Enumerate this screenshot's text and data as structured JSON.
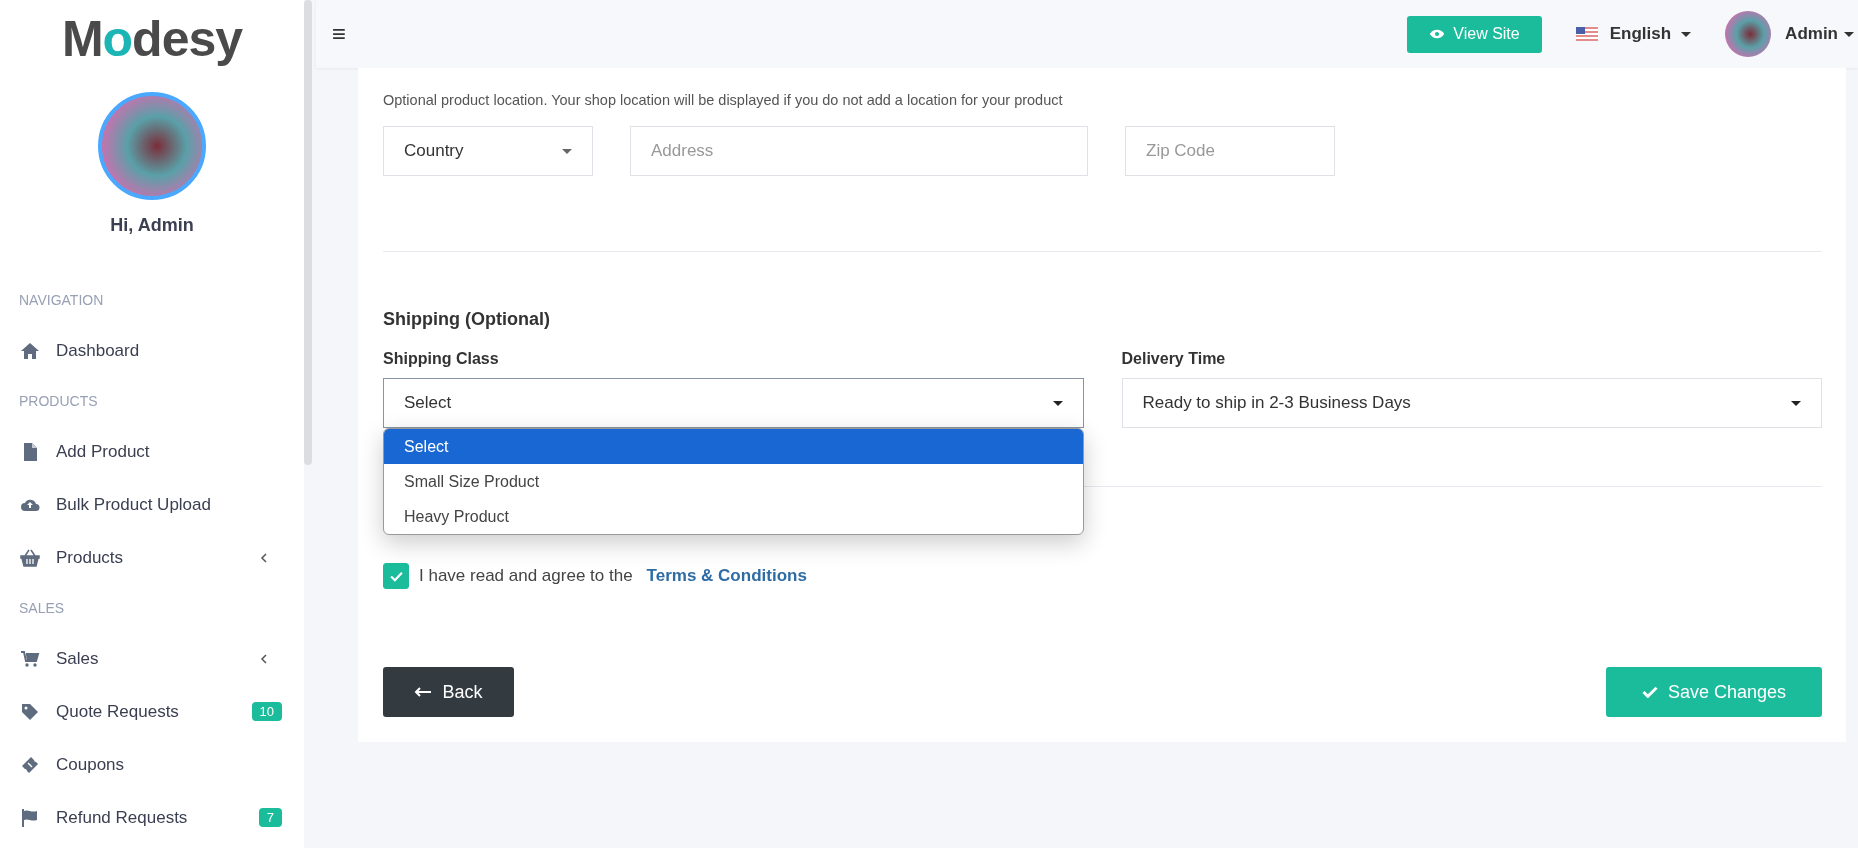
{
  "sidebar": {
    "logo": {
      "before": "M",
      "accent": "o",
      "after": "desy"
    },
    "greeting": "Hi, Admin",
    "sections": [
      {
        "title": "NAVIGATION",
        "items": [
          {
            "label": "Dashboard",
            "expandable": false
          }
        ]
      },
      {
        "title": "PRODUCTS",
        "items": [
          {
            "label": "Add Product",
            "expandable": false
          },
          {
            "label": "Bulk Product Upload",
            "expandable": false
          },
          {
            "label": "Products",
            "expandable": true
          }
        ]
      },
      {
        "title": "SALES",
        "items": [
          {
            "label": "Sales",
            "expandable": true
          },
          {
            "label": "Quote Requests",
            "expandable": false,
            "badge": "10"
          },
          {
            "label": "Coupons",
            "expandable": false
          },
          {
            "label": "Refund Requests",
            "expandable": false,
            "badge": "7"
          }
        ]
      }
    ]
  },
  "header": {
    "menu_icon": "≡",
    "view_site": "View Site",
    "language": "English",
    "user": "Admin"
  },
  "location": {
    "hint": "Optional product location. Your shop location will be displayed if you do not add a location for your product",
    "country": "Country",
    "address": {
      "placeholder": "Address"
    },
    "zip": {
      "placeholder": "Zip Code"
    }
  },
  "shipping": {
    "title": "Shipping (Optional)",
    "class_label": "Shipping Class",
    "class_value": "Select",
    "delivery_label": "Delivery Time",
    "delivery_value": "Ready to ship in 2-3 Business Days",
    "dropdown": {
      "expanded": true,
      "options": [
        {
          "label": "Select",
          "selected": true
        },
        {
          "label": "Small Size Product",
          "selected": false
        },
        {
          "label": "Heavy Product",
          "selected": false
        }
      ]
    }
  },
  "terms": {
    "checked": true,
    "text": "I have read and agree to the",
    "link": "Terms & Conditions"
  },
  "buttons": {
    "back": "Back",
    "save": "Save Changes"
  }
}
